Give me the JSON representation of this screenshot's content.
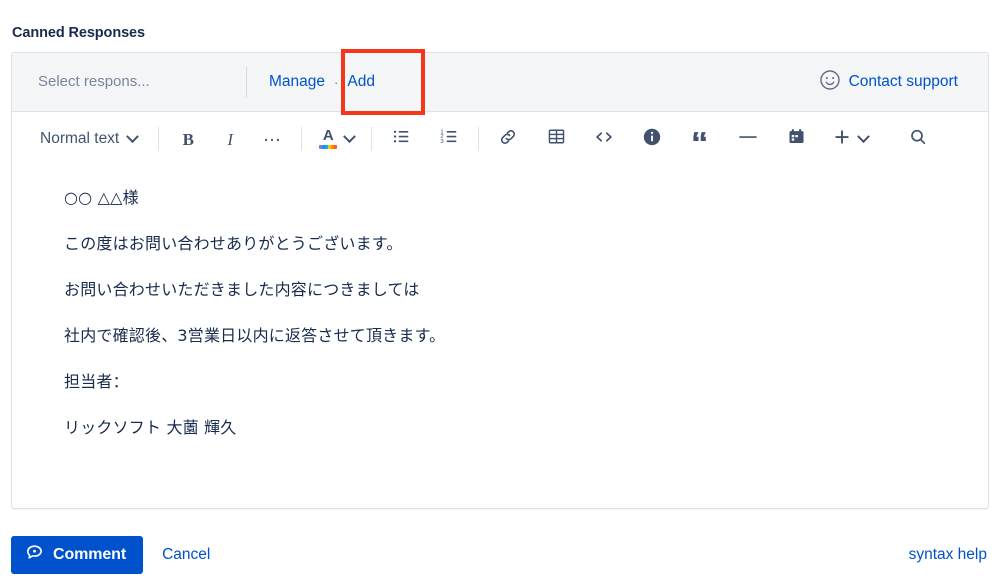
{
  "section": {
    "title": "Canned Responses"
  },
  "canned_bar": {
    "select_placeholder": "Select respons...",
    "manage_label": "Manage",
    "separator_dot": "·",
    "add_label": "Add",
    "contact_support_label": "Contact support",
    "smiley_icon": "smiley-face-icon",
    "highlight_color": "#f5361a",
    "background": "#f4f5f7"
  },
  "toolbar": {
    "text_style_label": "Normal text",
    "items": [
      {
        "name": "text-style-dropdown",
        "label": "Normal text",
        "icon": "chevron-down-icon"
      },
      {
        "name": "bold-button",
        "label": "B",
        "icon": "bold-icon"
      },
      {
        "name": "italic-button",
        "label": "I",
        "icon": "italic-icon"
      },
      {
        "name": "more-formatting-button",
        "label": "…",
        "icon": "ellipsis-icon"
      },
      {
        "name": "text-color-button",
        "label": "A",
        "icon": "text-color-icon"
      },
      {
        "name": "bullet-list-button",
        "label": "",
        "icon": "bullet-list-icon"
      },
      {
        "name": "numbered-list-button",
        "label": "",
        "icon": "numbered-list-icon"
      },
      {
        "name": "link-button",
        "label": "",
        "icon": "link-icon"
      },
      {
        "name": "table-button",
        "label": "",
        "icon": "table-icon"
      },
      {
        "name": "code-button",
        "label": "",
        "icon": "code-icon"
      },
      {
        "name": "info-panel-button",
        "label": "",
        "icon": "info-circle-icon"
      },
      {
        "name": "quote-button",
        "label": "",
        "icon": "quote-icon"
      },
      {
        "name": "horizontal-rule-button",
        "label": "",
        "icon": "horizontal-rule-icon"
      },
      {
        "name": "date-button",
        "label": "",
        "icon": "calendar-icon"
      },
      {
        "name": "insert-more-button",
        "label": "",
        "icon": "plus-icon"
      },
      {
        "name": "find-replace-button",
        "label": "",
        "icon": "search-icon"
      }
    ],
    "color_swatch": [
      "#8777d9",
      "#2684ff",
      "#00b8d9",
      "#ffc400",
      "#ff8b00",
      "#ff5630"
    ]
  },
  "document": {
    "lines": [
      "○○ △△様",
      "この度はお問い合わせありがとうございます。",
      "お問い合わせいただきました内容につきましては",
      "社内で確認後、3営業日以内に返答させて頂きます。",
      "担当者：",
      "リックソフト 大薗 輝久"
    ]
  },
  "footer": {
    "comment_label": "Comment",
    "comment_icon": "speech-bubble-icon",
    "cancel_label": "Cancel",
    "syntax_help_label": "syntax help",
    "primary_color": "#0052cc"
  }
}
